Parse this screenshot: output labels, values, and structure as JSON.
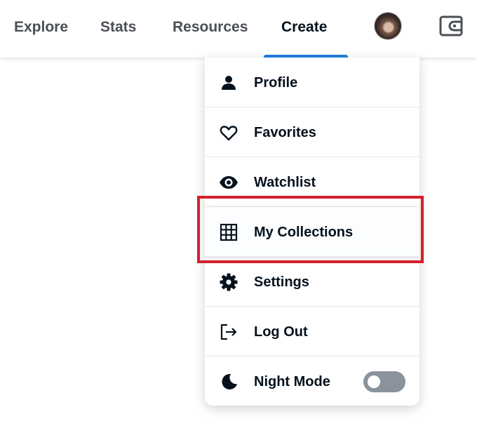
{
  "nav": {
    "items": [
      {
        "label": "Explore",
        "active": false
      },
      {
        "label": "Stats",
        "active": false
      },
      {
        "label": "Resources",
        "active": false
      },
      {
        "label": "Create",
        "active": true
      }
    ]
  },
  "colors": {
    "accent": "#2081e2",
    "text_primary": "#04111d",
    "text_nav": "#4a4f57",
    "divider": "#e5e8eb",
    "highlight_border": "#d6202c",
    "toggle_off": "#8a939b"
  },
  "dropdown": {
    "items": [
      {
        "label": "Profile",
        "icon": "person-icon"
      },
      {
        "label": "Favorites",
        "icon": "heart-icon"
      },
      {
        "label": "Watchlist",
        "icon": "eye-icon"
      },
      {
        "label": "My Collections",
        "icon": "grid-icon",
        "highlighted": true
      },
      {
        "label": "Settings",
        "icon": "gear-icon"
      },
      {
        "label": "Log Out",
        "icon": "logout-icon"
      },
      {
        "label": "Night Mode",
        "icon": "moon-icon",
        "toggle": false
      }
    ]
  }
}
